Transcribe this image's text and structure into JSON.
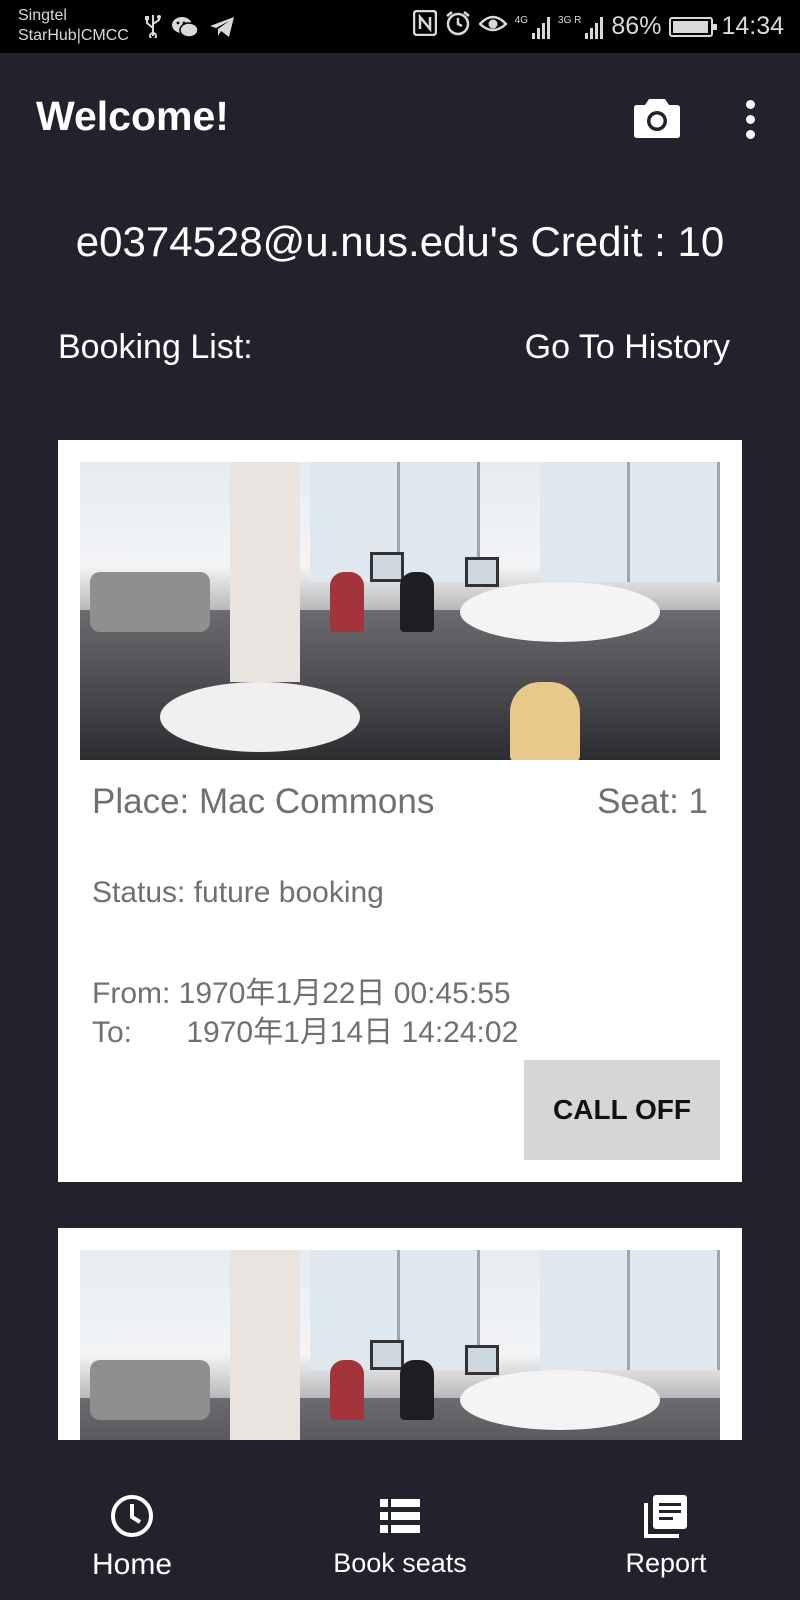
{
  "status_bar": {
    "carrier_1": "Singtel",
    "carrier_2": "StarHub|CMCC",
    "network_1": "4G",
    "network_2": "3G R",
    "battery": "86%",
    "time": "14:34",
    "icons": [
      "usb-icon",
      "wechat-icon",
      "telegram-icon",
      "nfc-icon",
      "alarm-icon",
      "eye-comfort-icon",
      "signal-icon",
      "battery-icon"
    ]
  },
  "app_bar": {
    "title": "Welcome!",
    "actions": [
      "camera-icon",
      "more-vert-icon"
    ]
  },
  "credit_text": "e0374528@u.nus.edu's Credit : 10",
  "booking_list_label": "Booking List:",
  "history_link": "Go To History",
  "bookings": [
    {
      "place": "Place: Mac Commons",
      "seat": "Seat: 1",
      "status": "Status: future booking",
      "from_label": "From:",
      "from_value": "1970年1月22日 00:45:55",
      "to_label": "To:",
      "to_value": "1970年1月14日 14:24:02",
      "action": "CALL OFF"
    }
  ],
  "bottom_nav": [
    {
      "label": "Home",
      "icon": "clock-icon"
    },
    {
      "label": "Book seats",
      "icon": "list-icon"
    },
    {
      "label": "Report",
      "icon": "report-icon"
    }
  ],
  "colors": {
    "background": "#21222c",
    "card": "#ffffff",
    "button": "#d6d6d6",
    "card_text": "#707070"
  }
}
